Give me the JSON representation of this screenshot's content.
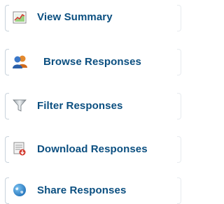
{
  "nav": {
    "items": [
      {
        "label": "View Summary",
        "icon": "chart-icon"
      },
      {
        "label": "Browse Responses",
        "icon": "users-icon"
      },
      {
        "label": "Filter Responses",
        "icon": "filter-icon"
      },
      {
        "label": "Download Responses",
        "icon": "download-icon"
      },
      {
        "label": "Share Responses",
        "icon": "globe-icon"
      }
    ]
  },
  "colors": {
    "link_text": "#0b4f80",
    "tab_border": "#c9d3dc"
  }
}
